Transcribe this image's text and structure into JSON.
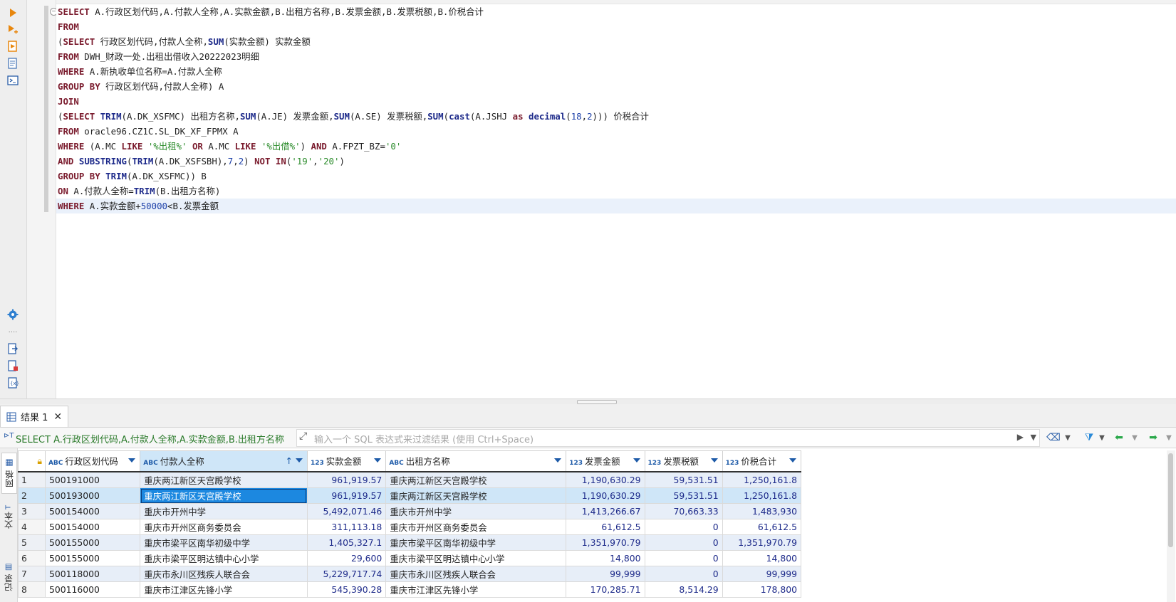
{
  "editor": {
    "lines": [
      [
        {
          "t": "SELECT",
          "c": "kw"
        },
        {
          "t": " A.行政区划代码,A.付款人全称,A.实款金额,B.出租方名称,B.发票金额,B.发票税额,B.价税合计",
          "c": ""
        }
      ],
      [
        {
          "t": "FROM",
          "c": "kw"
        }
      ],
      [
        {
          "t": "(",
          "c": ""
        },
        {
          "t": "SELECT",
          "c": "kw"
        },
        {
          "t": " 行政区划代码,付款人全称,",
          "c": ""
        },
        {
          "t": "SUM",
          "c": "fn"
        },
        {
          "t": "(实款金额) 实款金额",
          "c": ""
        }
      ],
      [
        {
          "t": "FROM",
          "c": "kw"
        },
        {
          "t": " DWH_财政一处.出租出借收入20222023明细",
          "c": ""
        }
      ],
      [
        {
          "t": "WHERE",
          "c": "kw"
        },
        {
          "t": " A.新执收单位名称=A.付款人全称",
          "c": ""
        }
      ],
      [
        {
          "t": "GROUP BY",
          "c": "kw"
        },
        {
          "t": " 行政区划代码,付款人全称) A",
          "c": ""
        }
      ],
      [
        {
          "t": "JOIN",
          "c": "kw"
        }
      ],
      [
        {
          "t": "(",
          "c": ""
        },
        {
          "t": "SELECT",
          "c": "kw"
        },
        {
          "t": " ",
          "c": ""
        },
        {
          "t": "TRIM",
          "c": "fn"
        },
        {
          "t": "(A.DK_XSFMC) 出租方名称,",
          "c": ""
        },
        {
          "t": "SUM",
          "c": "fn"
        },
        {
          "t": "(A.JE) 发票金额,",
          "c": ""
        },
        {
          "t": "SUM",
          "c": "fn"
        },
        {
          "t": "(A.SE) 发票税额,",
          "c": ""
        },
        {
          "t": "SUM",
          "c": "fn"
        },
        {
          "t": "(",
          "c": ""
        },
        {
          "t": "cast",
          "c": "fn"
        },
        {
          "t": "(A.JSHJ ",
          "c": ""
        },
        {
          "t": "as",
          "c": "kw"
        },
        {
          "t": " ",
          "c": ""
        },
        {
          "t": "decimal",
          "c": "fn"
        },
        {
          "t": "(",
          "c": ""
        },
        {
          "t": "18",
          "c": "num"
        },
        {
          "t": ",",
          "c": ""
        },
        {
          "t": "2",
          "c": "num"
        },
        {
          "t": "))) 价税合计",
          "c": ""
        }
      ],
      [
        {
          "t": "FROM",
          "c": "kw"
        },
        {
          "t": " oracle96.CZ1C.SL_DK_XF_FPMX A",
          "c": ""
        }
      ],
      [
        {
          "t": "WHERE",
          "c": "kw"
        },
        {
          "t": " (A.MC ",
          "c": ""
        },
        {
          "t": "LIKE",
          "c": "kw"
        },
        {
          "t": " ",
          "c": ""
        },
        {
          "t": "'%出租%'",
          "c": "str"
        },
        {
          "t": " ",
          "c": ""
        },
        {
          "t": "OR",
          "c": "kw"
        },
        {
          "t": " A.MC ",
          "c": ""
        },
        {
          "t": "LIKE",
          "c": "kw"
        },
        {
          "t": " ",
          "c": ""
        },
        {
          "t": "'%出借%'",
          "c": "str"
        },
        {
          "t": ") ",
          "c": ""
        },
        {
          "t": "AND",
          "c": "kw"
        },
        {
          "t": " A.FPZT_BZ=",
          "c": ""
        },
        {
          "t": "'0'",
          "c": "str"
        }
      ],
      [
        {
          "t": "AND",
          "c": "kw"
        },
        {
          "t": " ",
          "c": ""
        },
        {
          "t": "SUBSTRING",
          "c": "fn"
        },
        {
          "t": "(",
          "c": ""
        },
        {
          "t": "TRIM",
          "c": "fn"
        },
        {
          "t": "(A.DK_XSFSBH),",
          "c": ""
        },
        {
          "t": "7",
          "c": "num"
        },
        {
          "t": ",",
          "c": ""
        },
        {
          "t": "2",
          "c": "num"
        },
        {
          "t": ") ",
          "c": ""
        },
        {
          "t": "NOT IN",
          "c": "kw"
        },
        {
          "t": "(",
          "c": ""
        },
        {
          "t": "'19'",
          "c": "str"
        },
        {
          "t": ",",
          "c": ""
        },
        {
          "t": "'20'",
          "c": "str"
        },
        {
          "t": ")",
          "c": ""
        }
      ],
      [
        {
          "t": "GROUP BY",
          "c": "kw"
        },
        {
          "t": " ",
          "c": ""
        },
        {
          "t": "TRIM",
          "c": "fn"
        },
        {
          "t": "(A.DK_XSFMC)) B",
          "c": ""
        }
      ],
      [
        {
          "t": "ON",
          "c": "kw"
        },
        {
          "t": " A.付款人全称=",
          "c": ""
        },
        {
          "t": "TRIM",
          "c": "fn"
        },
        {
          "t": "(B.出租方名称)",
          "c": ""
        }
      ],
      [
        {
          "t": "WHERE",
          "c": "kw"
        },
        {
          "t": " A.实款金额+",
          "c": ""
        },
        {
          "t": "50000",
          "c": "num"
        },
        {
          "t": "<B.发票金额",
          "c": ""
        }
      ]
    ]
  },
  "results": {
    "tab_label": "结果 1",
    "query_preview": "SELECT A.行政区划代码,A.付款人全称,A.实款金额,B.出租方名称",
    "filter_placeholder": "输入一个 SQL 表达式来过滤结果 (使用 Ctrl+Space)",
    "side_tabs": [
      "网格",
      "文本",
      "记录"
    ],
    "columns": [
      {
        "type": "ABC",
        "label": "行政区划代码"
      },
      {
        "type": "ABC",
        "label": "付款人全称"
      },
      {
        "type": "123",
        "label": "实款金额"
      },
      {
        "type": "ABC",
        "label": "出租方名称"
      },
      {
        "type": "123",
        "label": "发票金额"
      },
      {
        "type": "123",
        "label": "发票税额"
      },
      {
        "type": "123",
        "label": "价税合计"
      }
    ],
    "rows": [
      [
        "1",
        "500191000",
        "重庆两江新区天宫殿学校",
        "961,919.57",
        "重庆两江新区天宫殿学校",
        "1,190,630.29",
        "59,531.51",
        "1,250,161.8"
      ],
      [
        "2",
        "500193000",
        "重庆两江新区天宫殿学校",
        "961,919.57",
        "重庆两江新区天宫殿学校",
        "1,190,630.29",
        "59,531.51",
        "1,250,161.8"
      ],
      [
        "3",
        "500154000",
        "重庆市开州中学",
        "5,492,071.46",
        "重庆市开州中学",
        "1,413,266.67",
        "70,663.33",
        "1,483,930"
      ],
      [
        "4",
        "500154000",
        "重庆市开州区商务委员会",
        "311,113.18",
        "重庆市开州区商务委员会",
        "61,612.5",
        "0",
        "61,612.5"
      ],
      [
        "5",
        "500155000",
        "重庆市梁平区南华初级中学",
        "1,405,327.1",
        "重庆市梁平区南华初级中学",
        "1,351,970.79",
        "0",
        "1,351,970.79"
      ],
      [
        "6",
        "500155000",
        "重庆市梁平区明达镇中心小学",
        "29,600",
        "重庆市梁平区明达镇中心小学",
        "14,800",
        "0",
        "14,800"
      ],
      [
        "7",
        "500118000",
        "重庆市永川区残疾人联合会",
        "5,229,717.74",
        "重庆市永川区残疾人联合会",
        "99,999",
        "0",
        "99,999"
      ],
      [
        "8",
        "500116000",
        "重庆市江津区先锋小学",
        "545,390.28",
        "重庆市江津区先锋小学",
        "170,285.71",
        "8,514.29",
        "178,800"
      ]
    ]
  }
}
